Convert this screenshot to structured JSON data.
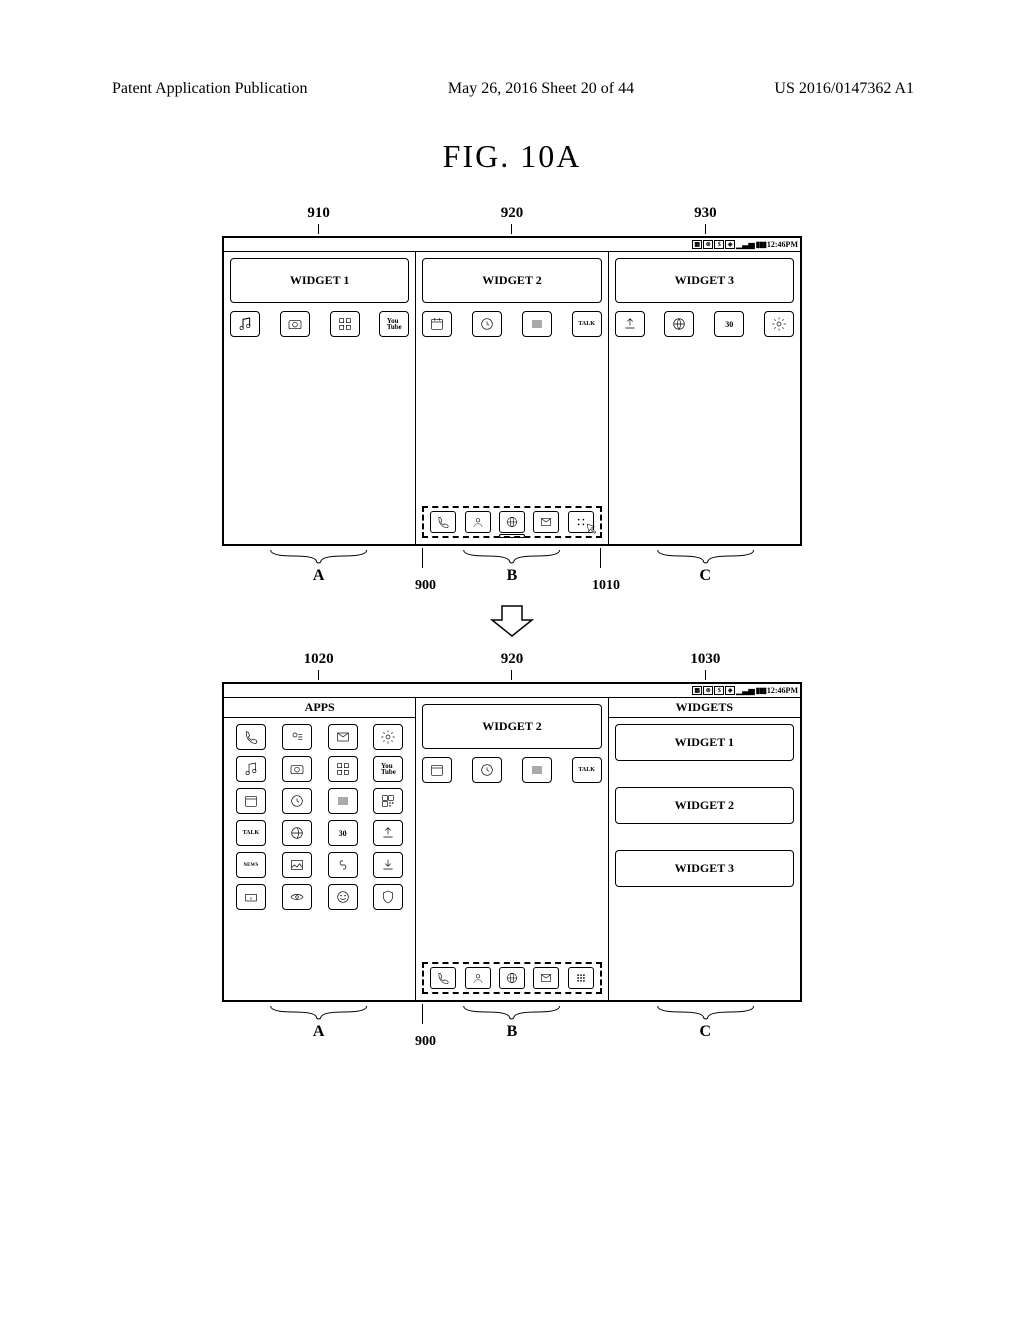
{
  "header": {
    "left": "Patent Application Publication",
    "center": "May 26, 2016  Sheet 20 of 44",
    "right": "US 2016/0147362 A1"
  },
  "figure_title": "FIG.  10A",
  "status_time": "12:46PM",
  "top": {
    "refs": [
      "910",
      "920",
      "930"
    ],
    "panel_a": {
      "widget": "WIDGET 1"
    },
    "panel_b": {
      "widget": "WIDGET 2"
    },
    "panel_c": {
      "widget": "WIDGET 3"
    },
    "brace_labels": [
      "A",
      "B",
      "C"
    ],
    "ref_900": "900",
    "ref_1010": "1010",
    "youtube": "You\nTube",
    "talk": "TALK",
    "cal": "30"
  },
  "bottom": {
    "refs": [
      "1020",
      "920",
      "1030"
    ],
    "panel_a_title": "APPS",
    "panel_c_title": "WIDGETS",
    "panel_b": {
      "widget": "WIDGET 2"
    },
    "panel_c": {
      "w1": "WIDGET 1",
      "w2": "WIDGET 2",
      "w3": "WIDGET 3"
    },
    "brace_labels": [
      "A",
      "B",
      "C"
    ],
    "ref_900": "900",
    "youtube": "You\nTube",
    "talk": "TALK",
    "cal": "30",
    "news": "NEWS"
  }
}
